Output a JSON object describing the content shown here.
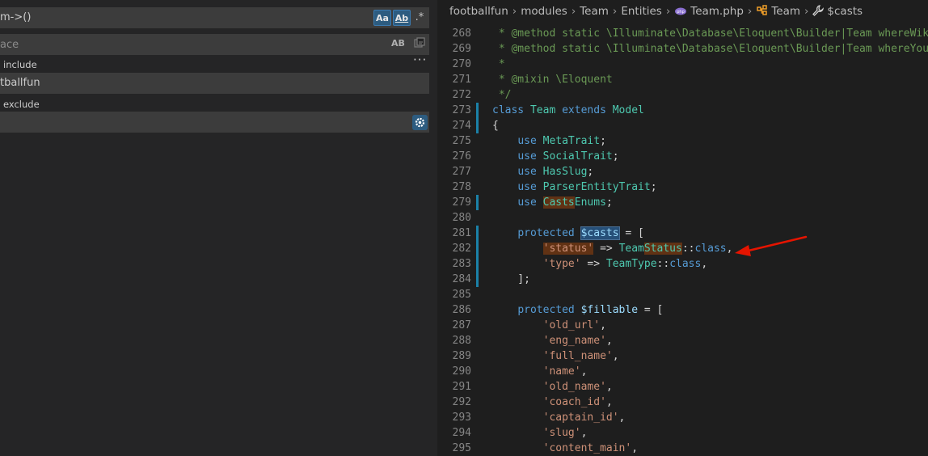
{
  "search": {
    "query": "m->()",
    "match_case": "Aa",
    "whole_word": "Ab",
    "regex": ".*",
    "replace_placeholder": "ace",
    "preserve_case": "AB",
    "include_label": "include",
    "include_value": "tballfun",
    "exclude_label": "exclude",
    "exclude_value": "",
    "more": "···"
  },
  "breadcrumb": [
    "footballfun",
    "modules",
    "Team",
    "Entities",
    "Team.php",
    "Team",
    "$casts"
  ],
  "colors": {
    "accent": "#2d5c80",
    "arrow": "#e51400",
    "gutter_modified": "#1b81a8"
  },
  "code": [
    {
      "n": "268",
      "t": " * @method static \\Illuminate\\Database\\Eloquent\\Builder|Team whereWiki"
    },
    {
      "n": "269",
      "t": " * @method static \\Illuminate\\Database\\Eloquent\\Builder|Team whereYout"
    },
    {
      "n": "270",
      "t": " *"
    },
    {
      "n": "271",
      "t": " * @mixin \\Eloquent"
    },
    {
      "n": "272",
      "t": " */"
    },
    {
      "n": "273",
      "t": "class Team extends Model"
    },
    {
      "n": "274",
      "t": "{"
    },
    {
      "n": "275",
      "t": "    use MetaTrait;"
    },
    {
      "n": "276",
      "t": "    use SocialTrait;"
    },
    {
      "n": "277",
      "t": "    use HasSlug;"
    },
    {
      "n": "278",
      "t": "    use ParserEntityTrait;"
    },
    {
      "n": "279",
      "t": "    use CastsEnums;"
    },
    {
      "n": "280",
      "t": ""
    },
    {
      "n": "281",
      "t": "    protected $casts = ["
    },
    {
      "n": "282",
      "t": "        'status' => TeamStatus::class,"
    },
    {
      "n": "283",
      "t": "        'type' => TeamType::class,"
    },
    {
      "n": "284",
      "t": "    ];"
    },
    {
      "n": "285",
      "t": ""
    },
    {
      "n": "286",
      "t": "    protected $fillable = ["
    },
    {
      "n": "287",
      "t": "        'old_url',"
    },
    {
      "n": "288",
      "t": "        'eng_name',"
    },
    {
      "n": "289",
      "t": "        'full_name',"
    },
    {
      "n": "290",
      "t": "        'name',"
    },
    {
      "n": "291",
      "t": "        'old_name',"
    },
    {
      "n": "292",
      "t": "        'coach_id',"
    },
    {
      "n": "293",
      "t": "        'captain_id',"
    },
    {
      "n": "294",
      "t": "        'slug',"
    },
    {
      "n": "295",
      "t": "        'content_main',"
    }
  ]
}
